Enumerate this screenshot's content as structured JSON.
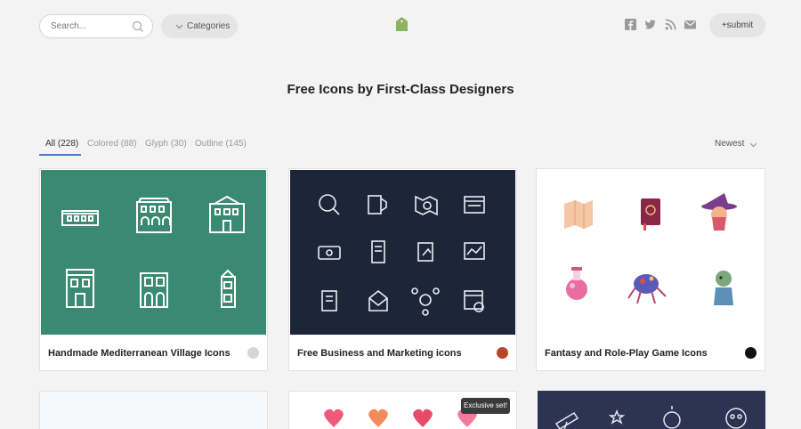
{
  "header": {
    "search_placeholder": "Search...",
    "categories_label": "Categories",
    "submit_label": "+submit",
    "social_icons": [
      "facebook-icon",
      "twitter-icon",
      "rss-icon",
      "mail-icon"
    ],
    "logo_color": "#8cb35e"
  },
  "page": {
    "title": "Free Icons by First-Class Designers"
  },
  "tabs": [
    {
      "label": "All (228)",
      "active": true
    },
    {
      "label": "Colored (88)",
      "active": false
    },
    {
      "label": "Glyph (30)",
      "active": false
    },
    {
      "label": "Outline (145)",
      "active": false
    }
  ],
  "sort": {
    "label": "Newest"
  },
  "cards": [
    {
      "title": "Handmade Mediterranean Village Icons",
      "bg": "#3a8a72"
    },
    {
      "title": "Free Business and Marketing icons",
      "bg": "#1c2638"
    },
    {
      "title": "Fantasy and Role-Play Game Icons",
      "bg": "#ffffff"
    }
  ],
  "badge": {
    "label": "Exclusive set!"
  },
  "colors": {
    "accent": "#4d7cc7",
    "brand": "#8cb35e"
  }
}
